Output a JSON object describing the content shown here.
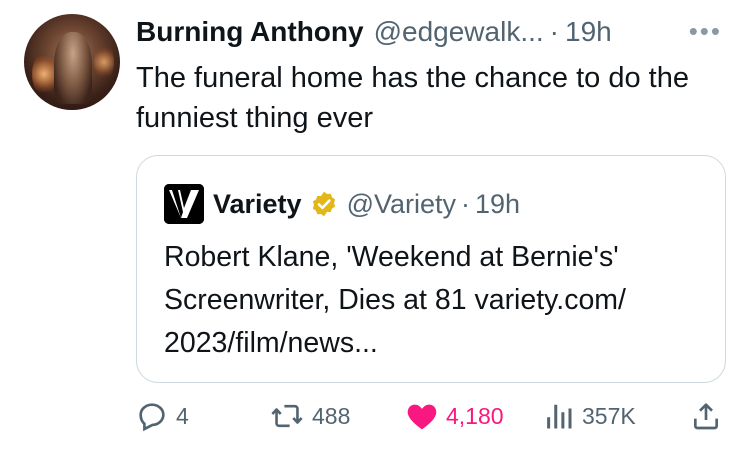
{
  "author": {
    "name": "Burning Anthony",
    "handle": "@edgewalk...",
    "separator": "·",
    "time": "19h",
    "more_icon": "more-horizontal-icon"
  },
  "tweet": {
    "text": "The funeral home has the chance to do the funniest thing ever"
  },
  "quote": {
    "name": "Variety",
    "handle": "@Variety",
    "separator": "·",
    "time": "19h",
    "verified": true,
    "badge_color": "#e2b719",
    "text": "Robert Klane, 'Weekend at Bernie's' Screenwriter, Dies at 81 variety.com/ 2023/film/news..."
  },
  "actions": {
    "replies": "4",
    "retweets": "488",
    "likes": "4,180",
    "liked": true,
    "views": "357K",
    "like_color": "#f91880",
    "muted_color": "#536471"
  }
}
